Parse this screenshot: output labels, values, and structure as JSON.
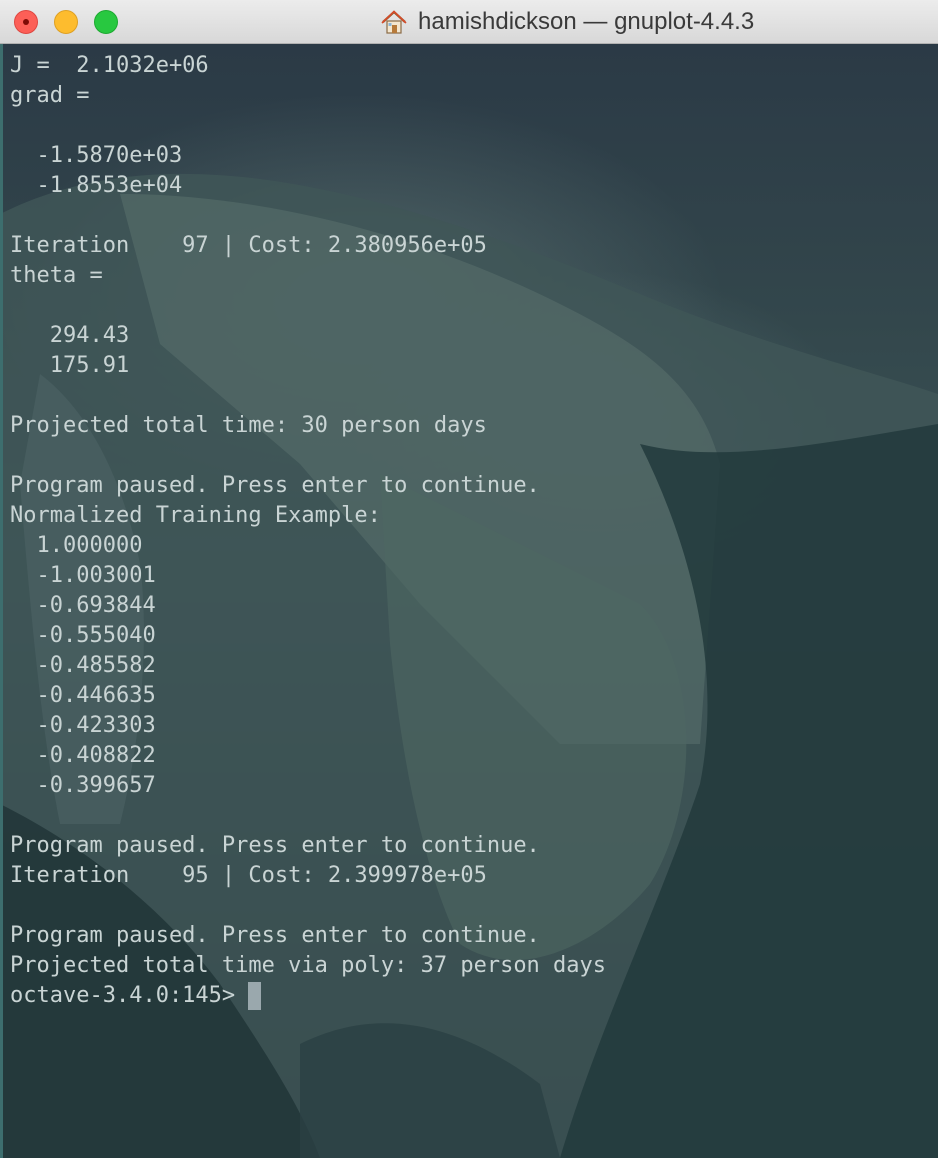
{
  "window": {
    "title": "hamishdickson — gnuplot-4.4.3",
    "title_icon": "home-icon",
    "controls": [
      "close-button",
      "minimize-button",
      "zoom-button"
    ]
  },
  "terminal": {
    "lines": [
      "J =  2.1032e+06",
      "grad =",
      "",
      "  -1.5870e+03",
      "  -1.8553e+04",
      "",
      "Iteration    97 | Cost: 2.380956e+05",
      "theta =",
      "",
      "   294.43",
      "   175.91",
      "",
      "Projected total time: 30 person days",
      "",
      "Program paused. Press enter to continue.",
      "Normalized Training Example:",
      "  1.000000",
      "  -1.003001",
      "  -0.693844",
      "  -0.555040",
      "  -0.485582",
      "  -0.446635",
      "  -0.423303",
      "  -0.408822",
      "  -0.399657",
      "",
      "Program paused. Press enter to continue.",
      "Iteration    95 | Cost: 2.399978e+05",
      "",
      "Program paused. Press enter to continue.",
      "Projected total time via poly: 37 person days"
    ],
    "prompt": "octave-3.4.0:145>"
  },
  "colors": {
    "text": "#c9d4d4",
    "cursor": "#9aa8ad",
    "close": "#fc5f57",
    "minimize": "#fdbc2e",
    "zoom": "#28c840"
  }
}
